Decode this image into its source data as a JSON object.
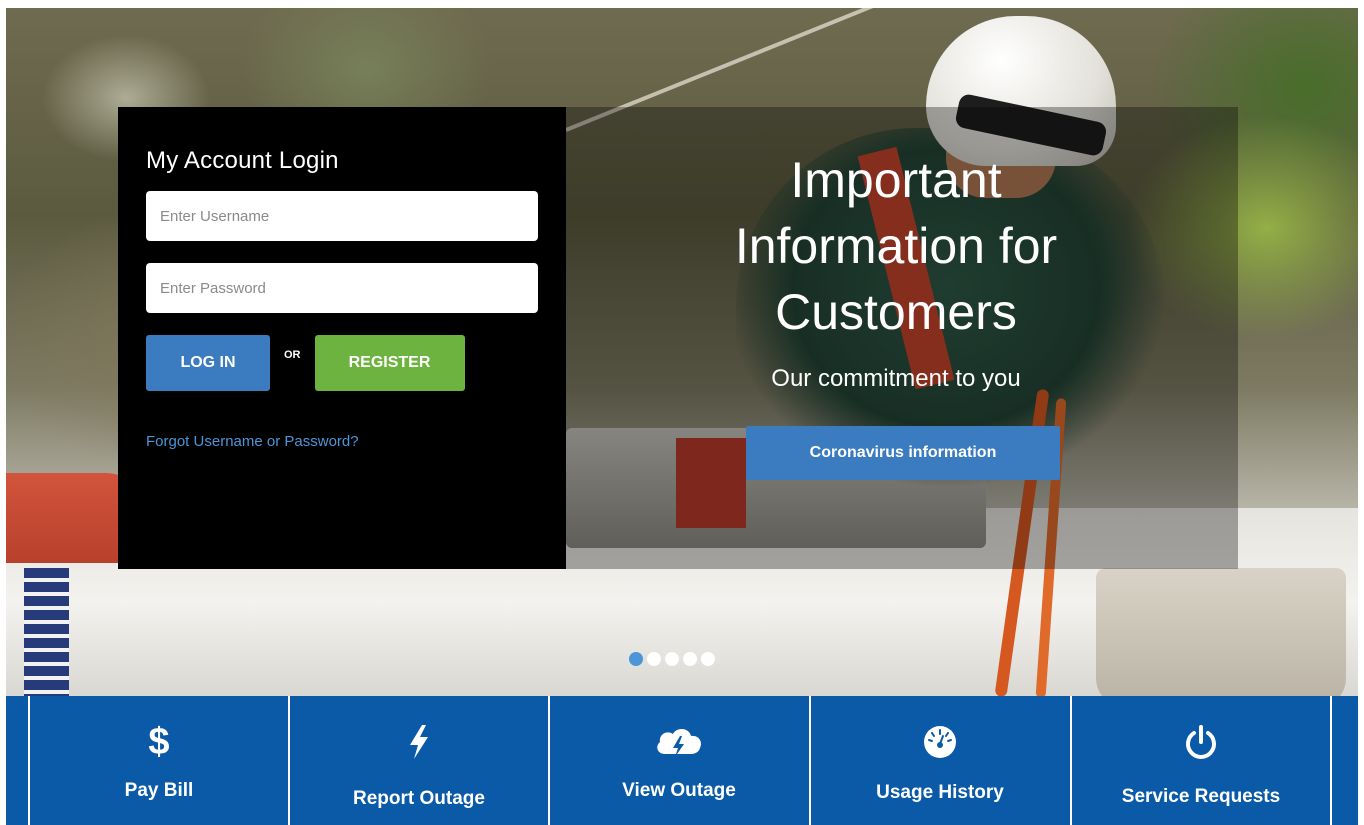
{
  "login": {
    "title": "My Account Login",
    "username_placeholder": "Enter Username",
    "password_placeholder": "Enter Password",
    "login_label": "LOG IN",
    "or_label": "OR",
    "register_label": "REGISTER",
    "forgot_label": "Forgot Username or Password?"
  },
  "promo": {
    "title": "Important Information for Customers",
    "subtitle": "Our commitment to you",
    "button_label": "Coronavirus information"
  },
  "carousel": {
    "slide_count": 5,
    "active_index": 0
  },
  "quick_links": [
    {
      "label": "Pay Bill",
      "icon": "dollar-icon"
    },
    {
      "label": "Report Outage",
      "icon": "lightning-bolt-icon"
    },
    {
      "label": "View Outage",
      "icon": "storm-cloud-icon"
    },
    {
      "label": "Usage History",
      "icon": "gauge-icon"
    },
    {
      "label": "Service Requests",
      "icon": "power-icon"
    }
  ],
  "colors": {
    "login_blue": "#3b7cc1",
    "register_green": "#6db33f",
    "link_blue": "#4c95d6",
    "quickbar_blue": "#0a5aa8"
  }
}
